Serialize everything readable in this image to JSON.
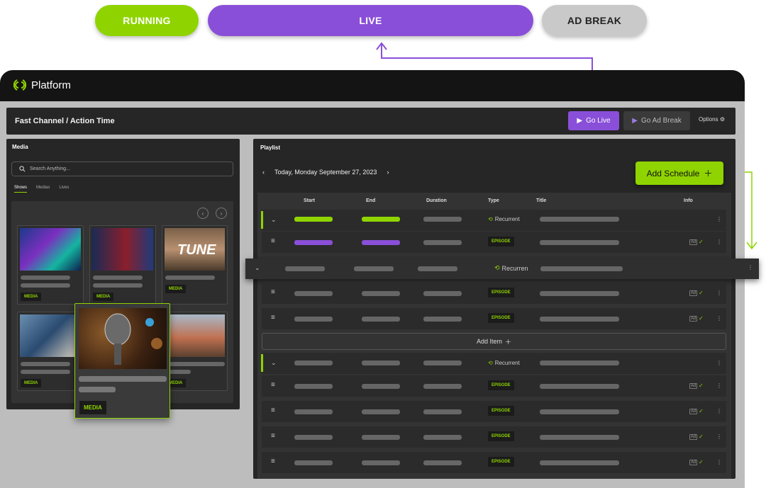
{
  "status_pills": {
    "running": "RUNNING",
    "live": "LIVE",
    "ad_break": "AD BREAK"
  },
  "app": {
    "name": "Platform"
  },
  "header": {
    "title": "Fast Channel / Action Time",
    "go_live": "Go Live",
    "go_ad_break": "Go Ad Break",
    "options": "Options"
  },
  "media": {
    "title": "Media",
    "search_placeholder": "Search Anything...",
    "tabs": [
      "Shows",
      "Medias",
      "Lives"
    ],
    "card_tag": "MEDIA",
    "drag_tag": "MEDIA"
  },
  "playlist": {
    "title": "Playlist",
    "date": "Today, Monday September 27, 2023",
    "add_schedule": "Add Schedule",
    "add_item": "Add Item",
    "columns": [
      "Start",
      "End",
      "Duration",
      "Type",
      "Title",
      "Info"
    ],
    "recurrent": "Recurrent",
    "recurrent_floating": "Recurren",
    "episode": "EPISODE",
    "ad_icon": "Ad"
  },
  "colors": {
    "accent_green": "#8fd400",
    "accent_purple": "#8a4fd8",
    "panel": "#262626"
  }
}
